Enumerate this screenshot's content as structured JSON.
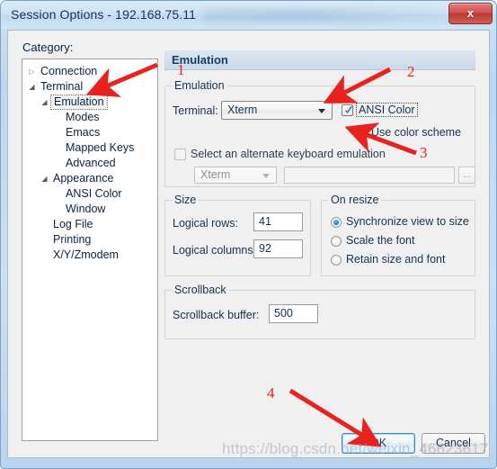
{
  "window": {
    "title": "Session Options - 192.168.75.11",
    "close_label": "x"
  },
  "dialog": {
    "category_label": "Category:"
  },
  "tree": {
    "items": [
      {
        "label": "Connection",
        "indent": 0,
        "expander": "collapsed",
        "selected": false
      },
      {
        "label": "Terminal",
        "indent": 0,
        "expander": "expanded",
        "selected": false
      },
      {
        "label": "Emulation",
        "indent": 1,
        "expander": "expanded",
        "selected": true
      },
      {
        "label": "Modes",
        "indent": 2,
        "expander": "none",
        "selected": false
      },
      {
        "label": "Emacs",
        "indent": 2,
        "expander": "none",
        "selected": false
      },
      {
        "label": "Mapped Keys",
        "indent": 2,
        "expander": "none",
        "selected": false
      },
      {
        "label": "Advanced",
        "indent": 2,
        "expander": "none",
        "selected": false
      },
      {
        "label": "Appearance",
        "indent": 1,
        "expander": "expanded",
        "selected": false
      },
      {
        "label": "ANSI Color",
        "indent": 2,
        "expander": "none",
        "selected": false
      },
      {
        "label": "Window",
        "indent": 2,
        "expander": "none",
        "selected": false
      },
      {
        "label": "Log File",
        "indent": 1,
        "expander": "none",
        "selected": false
      },
      {
        "label": "Printing",
        "indent": 1,
        "expander": "none",
        "selected": false
      },
      {
        "label": "X/Y/Zmodem",
        "indent": 1,
        "expander": "none",
        "selected": false
      }
    ]
  },
  "pane": {
    "header": "Emulation",
    "emulation_group": {
      "title": "Emulation",
      "terminal_label": "Terminal:",
      "terminal_value": "Xterm",
      "ansi_color_label": "ANSI Color",
      "ansi_color_checked": true,
      "use_color_scheme_label": "Use color scheme",
      "use_color_scheme_checked": true,
      "alt_keyboard_label": "Select an alternate keyboard emulation",
      "alt_keyboard_checked": false,
      "alt_keyboard_combo_value": "Xterm",
      "alt_keyboard_path_value": "",
      "browse_label": "..."
    },
    "size_group": {
      "title": "Size",
      "rows_label": "Logical rows:",
      "rows_value": "41",
      "cols_label": "Logical columns:",
      "cols_value": "92"
    },
    "resize_group": {
      "title": "On resize",
      "options": [
        {
          "label": "Synchronize view to size",
          "selected": true
        },
        {
          "label": "Scale the font",
          "selected": false
        },
        {
          "label": "Retain size and font",
          "selected": false
        }
      ]
    },
    "scrollback_group": {
      "title": "Scrollback",
      "buffer_label": "Scrollback buffer:",
      "buffer_value": "500"
    }
  },
  "footer": {
    "ok_label": "OK",
    "cancel_label": "Cancel"
  },
  "annotations": {
    "color": "#e8231f",
    "numbers": [
      "1",
      "2",
      "3",
      "4"
    ]
  },
  "watermark": {
    "text": "https://blog.csdn.net/weixin_46623617"
  }
}
